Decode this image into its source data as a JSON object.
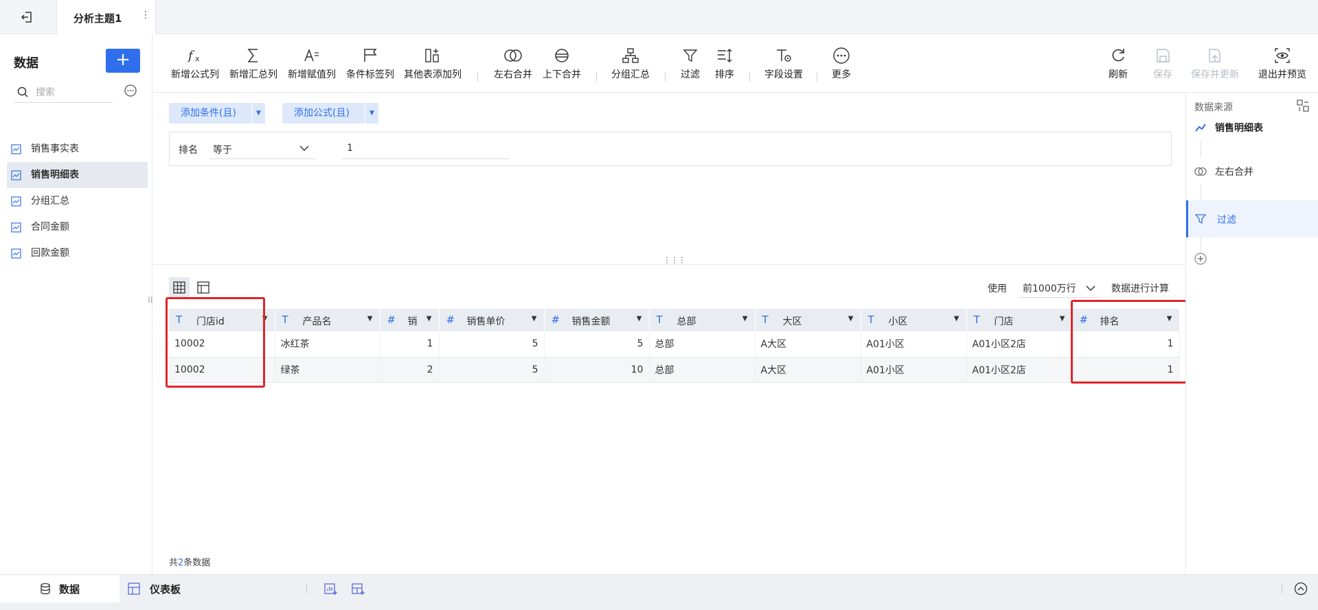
{
  "topbar": {
    "tab_title": "分析主题1",
    "more": "⋮"
  },
  "sidebar": {
    "title": "数据",
    "add": "+",
    "search_placeholder": "搜索",
    "items": [
      {
        "label": "销售事实表"
      },
      {
        "label": "销售明细表"
      },
      {
        "label": "分组汇总"
      },
      {
        "label": "合同金额"
      },
      {
        "label": "回款金额"
      }
    ]
  },
  "toolbar": {
    "formula": "新增公式列",
    "summary": "新增汇总列",
    "assign": "新增赋值列",
    "condition_tag": "条件标签列",
    "other_table": "其他表添加列",
    "lr_merge": "左右合并",
    "ud_merge": "上下合并",
    "group": "分组汇总",
    "filter": "过滤",
    "sort": "排序",
    "field_settings": "字段设置",
    "more": "更多",
    "refresh": "刷新",
    "save": "保存",
    "save_update": "保存并更新",
    "exit_preview": "退出并预览"
  },
  "filter": {
    "add_condition": "添加条件(且)",
    "add_formula": "添加公式(且)",
    "field": "排名",
    "operator": "等于",
    "value": "1"
  },
  "data": {
    "use_label": "使用",
    "row_limit": "前1000万行",
    "calc_label": "数据进行计算",
    "count_prefix": "共",
    "count": "2",
    "count_suffix": "条数据",
    "columns": [
      {
        "type": "T",
        "name": "门店id"
      },
      {
        "type": "#",
        "name": "产品名",
        "type_override": "T"
      },
      {
        "type": "#",
        "name": "销"
      },
      {
        "type": "#",
        "name": "销售单价"
      },
      {
        "type": "#",
        "name": "销售金额"
      },
      {
        "type": "T",
        "name": "总部"
      },
      {
        "type": "T",
        "name": "大区"
      },
      {
        "type": "T",
        "name": "小区"
      },
      {
        "type": "T",
        "name": "门店"
      },
      {
        "type": "#",
        "name": "排名"
      }
    ],
    "rows": [
      [
        "10002",
        "冰红茶",
        "1",
        "5",
        "5",
        "总部",
        "A大区",
        "A01小区",
        "A01小区2店",
        "1"
      ],
      [
        "10002",
        "绿茶",
        "2",
        "5",
        "10",
        "总部",
        "A大区",
        "A01小区",
        "A01小区2店",
        "1"
      ]
    ]
  },
  "right_panel": {
    "title": "数据来源",
    "steps": [
      {
        "label": "销售明细表"
      },
      {
        "label": "左右合并"
      },
      {
        "label": "过滤"
      }
    ]
  },
  "bottom": {
    "data_tab": "数据",
    "dashboard_tab": "仪表板"
  },
  "colors": {
    "accent": "#2f6fed",
    "highlight": "#e0242b"
  }
}
